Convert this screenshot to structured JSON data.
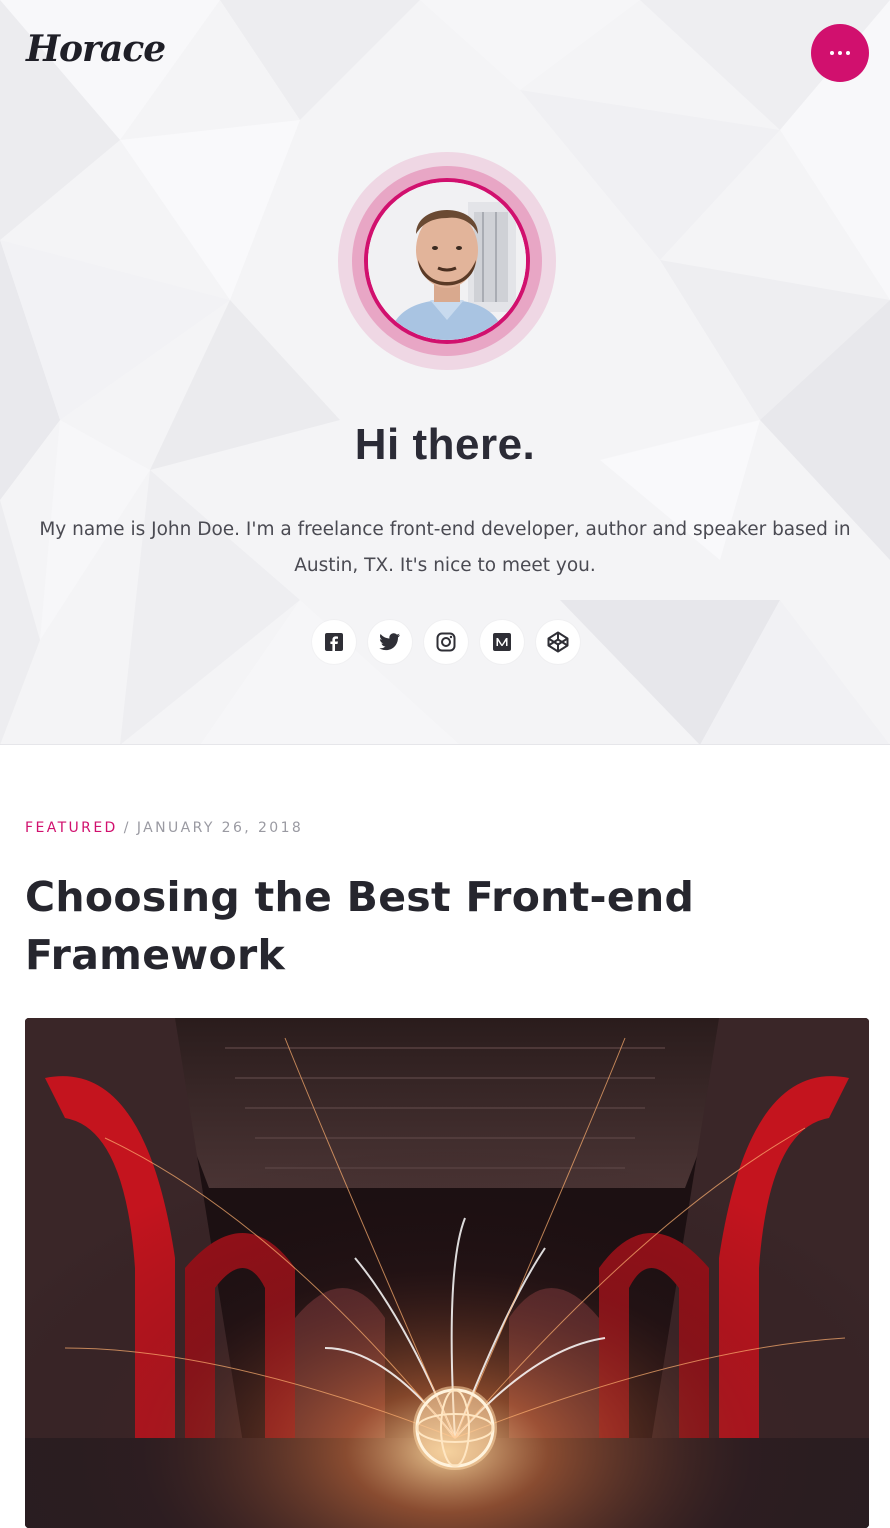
{
  "header": {
    "logo": "Horace",
    "menu_icon": "more-horizontal-icon",
    "accent_color": "#d1106e"
  },
  "hero": {
    "avatar_alt": "John Doe",
    "title": "Hi there.",
    "bio": "My name is John Doe. I'm a freelance front-end developer, author and speaker based in Austin, TX. It's nice to meet you.",
    "socials": [
      {
        "icon": "facebook-icon"
      },
      {
        "icon": "twitter-icon"
      },
      {
        "icon": "instagram-icon"
      },
      {
        "icon": "medium-icon"
      },
      {
        "icon": "codepen-icon"
      }
    ]
  },
  "post": {
    "category": "FEATURED",
    "separator": "/",
    "date": "JANUARY 26, 2018",
    "title": "Choosing the Best Front-end Framework",
    "image_alt": "Steel wool light painting in a ruined arched hall"
  }
}
